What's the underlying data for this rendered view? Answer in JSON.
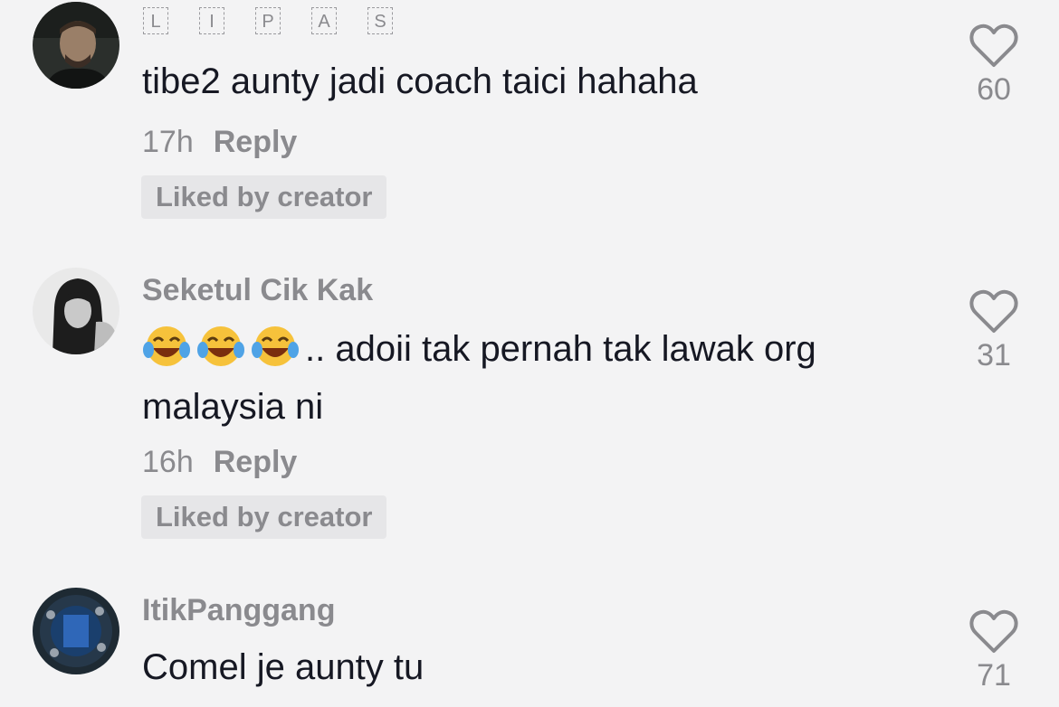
{
  "comments": [
    {
      "username_chars": [
        "L",
        "I",
        "P",
        "A",
        "S"
      ],
      "text": "tibe2 aunty jadi coach taici hahaha",
      "time": "17h",
      "reply_label": "Reply",
      "badge": "Liked by creator",
      "likes": "60"
    },
    {
      "username": "Seketul Cik Kak",
      "text": ".. adoii tak pernah tak lawak org malaysia ni",
      "time": "16h",
      "reply_label": "Reply",
      "badge": "Liked by creator",
      "likes": "31",
      "emoji": "face-with-tears-of-joy-icon"
    },
    {
      "username": "ItikPanggang",
      "text": "Comel je aunty tu",
      "likes": "71"
    }
  ],
  "colors": {
    "background": "#f3f3f4",
    "text": "#161823",
    "muted": "#8a8a8e",
    "badge_bg": "#e6e6e8"
  }
}
